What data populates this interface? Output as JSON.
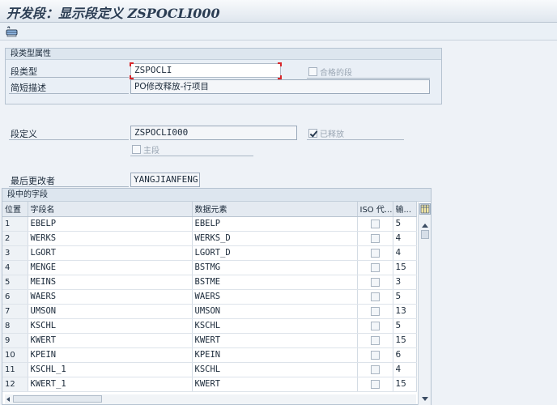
{
  "title": "开发段：显示段定义 ZSPOCLI000",
  "toolbar": {
    "icon": "glasses-icon"
  },
  "attr_group": {
    "title": "段类型属性",
    "segment_type_label": "段类型",
    "segment_type_value": "ZSPOCLI",
    "qualified_label": "合格的段",
    "desc_label": "简短描述",
    "desc_value": "PO修改释放-行项目"
  },
  "definition": {
    "label": "段定义",
    "value": "ZSPOCLI000",
    "released_label": "已释放",
    "main_label": "主段"
  },
  "changed_by": {
    "label": "最后更改者",
    "value": "YANGJIANFENG"
  },
  "fields_table": {
    "title": "段中的字段",
    "headers": [
      "位置",
      "字段名",
      "数据元素",
      "ISO 代...",
      "输..."
    ],
    "rows": [
      [
        "1",
        "EBELP",
        "EBELP",
        "5"
      ],
      [
        "2",
        "WERKS",
        "WERKS_D",
        "4"
      ],
      [
        "3",
        "LGORT",
        "LGORT_D",
        "4"
      ],
      [
        "4",
        "MENGE",
        "BSTMG",
        "15"
      ],
      [
        "5",
        "MEINS",
        "BSTME",
        "3"
      ],
      [
        "6",
        "WAERS",
        "WAERS",
        "5"
      ],
      [
        "7",
        "UMSON",
        "UMSON",
        "13"
      ],
      [
        "8",
        "KSCHL",
        "KSCHL",
        "5"
      ],
      [
        "9",
        "KWERT",
        "KWERT",
        "15"
      ],
      [
        "10",
        "KPEIN",
        "KPEIN",
        "6"
      ],
      [
        "11",
        "KSCHL_1",
        "KSCHL",
        "4"
      ],
      [
        "12",
        "KWERT_1",
        "KWERT",
        "15"
      ]
    ]
  },
  "colors": {
    "accent_red": "#d8262a",
    "title_text": "#2b3d53"
  }
}
